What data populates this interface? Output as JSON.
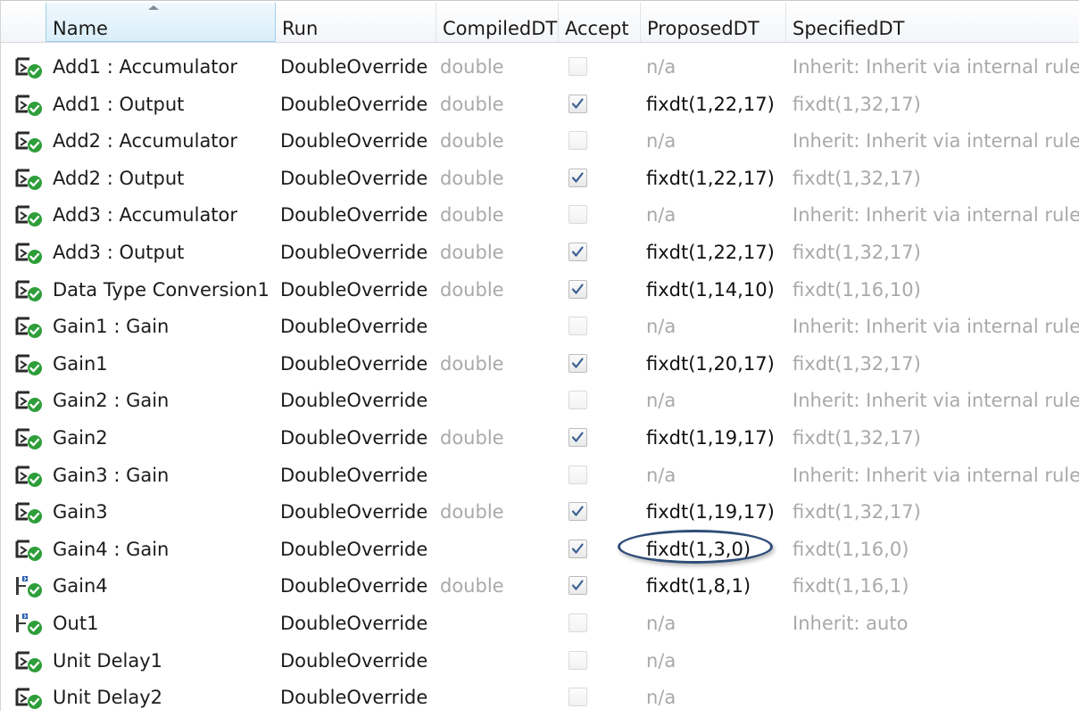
{
  "columns": {
    "name": "Name",
    "run": "Run",
    "compiled": "CompiledDT",
    "accept": "Accept",
    "proposed": "ProposedDT",
    "specified": "SpecifiedDT"
  },
  "colors": {
    "selected_header_bg": "#d9eefa",
    "grayed_text": "#a9a9a9",
    "icon_green": "#2e9e3a",
    "icon_blue": "#2a5db0",
    "highlight_oval": "#2f4d78"
  },
  "rows": [
    {
      "icon": "block-result-icon",
      "name": "Add1 : Accumulator",
      "run": "DoubleOverride",
      "compiled": "double",
      "accept": false,
      "accept_enabled": false,
      "proposed": "n/a",
      "specified": "Inherit: Inherit via internal rule"
    },
    {
      "icon": "block-result-icon",
      "name": "Add1 : Output",
      "run": "DoubleOverride",
      "compiled": "double",
      "accept": true,
      "accept_enabled": true,
      "proposed": "fixdt(1,22,17)",
      "specified": "fixdt(1,32,17)"
    },
    {
      "icon": "block-result-icon",
      "name": "Add2 : Accumulator",
      "run": "DoubleOverride",
      "compiled": "double",
      "accept": false,
      "accept_enabled": false,
      "proposed": "n/a",
      "specified": "Inherit: Inherit via internal rule"
    },
    {
      "icon": "block-result-icon",
      "name": "Add2 : Output",
      "run": "DoubleOverride",
      "compiled": "double",
      "accept": true,
      "accept_enabled": true,
      "proposed": "fixdt(1,22,17)",
      "specified": "fixdt(1,32,17)"
    },
    {
      "icon": "block-result-icon",
      "name": "Add3 : Accumulator",
      "run": "DoubleOverride",
      "compiled": "double",
      "accept": false,
      "accept_enabled": false,
      "proposed": "n/a",
      "specified": "Inherit: Inherit via internal rule"
    },
    {
      "icon": "block-result-icon",
      "name": "Add3 : Output",
      "run": "DoubleOverride",
      "compiled": "double",
      "accept": true,
      "accept_enabled": true,
      "proposed": "fixdt(1,22,17)",
      "specified": "fixdt(1,32,17)"
    },
    {
      "icon": "block-result-icon",
      "name": "Data Type Conversion1",
      "run": "DoubleOverride",
      "compiled": "double",
      "accept": true,
      "accept_enabled": true,
      "proposed": "fixdt(1,14,10)",
      "specified": "fixdt(1,16,10)"
    },
    {
      "icon": "block-result-icon",
      "name": "Gain1 : Gain",
      "run": "DoubleOverride",
      "compiled": "",
      "accept": false,
      "accept_enabled": false,
      "proposed": "n/a",
      "specified": "Inherit: Inherit via internal rule"
    },
    {
      "icon": "block-result-icon",
      "name": "Gain1",
      "run": "DoubleOverride",
      "compiled": "double",
      "accept": true,
      "accept_enabled": true,
      "proposed": "fixdt(1,20,17)",
      "specified": "fixdt(1,32,17)"
    },
    {
      "icon": "block-result-icon",
      "name": "Gain2 : Gain",
      "run": "DoubleOverride",
      "compiled": "",
      "accept": false,
      "accept_enabled": false,
      "proposed": "n/a",
      "specified": "Inherit: Inherit via internal rule"
    },
    {
      "icon": "block-result-icon",
      "name": "Gain2",
      "run": "DoubleOverride",
      "compiled": "double",
      "accept": true,
      "accept_enabled": true,
      "proposed": "fixdt(1,19,17)",
      "specified": "fixdt(1,32,17)"
    },
    {
      "icon": "block-result-icon",
      "name": "Gain3 : Gain",
      "run": "DoubleOverride",
      "compiled": "",
      "accept": false,
      "accept_enabled": false,
      "proposed": "n/a",
      "specified": "Inherit: Inherit via internal rule"
    },
    {
      "icon": "block-result-icon",
      "name": "Gain3",
      "run": "DoubleOverride",
      "compiled": "double",
      "accept": true,
      "accept_enabled": true,
      "proposed": "fixdt(1,19,17)",
      "specified": "fixdt(1,32,17)"
    },
    {
      "icon": "block-result-icon",
      "name": "Gain4 : Gain",
      "run": "DoubleOverride",
      "compiled": "",
      "accept": true,
      "accept_enabled": true,
      "proposed": "fixdt(1,3,0)",
      "specified": "fixdt(1,16,0)",
      "highlighted": true
    },
    {
      "icon": "signal-result-icon",
      "name": "Gain4",
      "run": "DoubleOverride",
      "compiled": "double",
      "accept": true,
      "accept_enabled": true,
      "proposed": "fixdt(1,8,1)",
      "specified": "fixdt(1,16,1)"
    },
    {
      "icon": "signal-result-icon",
      "name": "Out1",
      "run": "DoubleOverride",
      "compiled": "",
      "accept": false,
      "accept_enabled": false,
      "proposed": "n/a",
      "specified": "Inherit: auto"
    },
    {
      "icon": "block-result-icon",
      "name": "Unit Delay1",
      "run": "DoubleOverride",
      "compiled": "",
      "accept": false,
      "accept_enabled": false,
      "proposed": "n/a",
      "specified": ""
    },
    {
      "icon": "block-result-icon",
      "name": "Unit Delay2",
      "run": "DoubleOverride",
      "compiled": "",
      "accept": false,
      "accept_enabled": false,
      "proposed": "n/a",
      "specified": ""
    }
  ]
}
